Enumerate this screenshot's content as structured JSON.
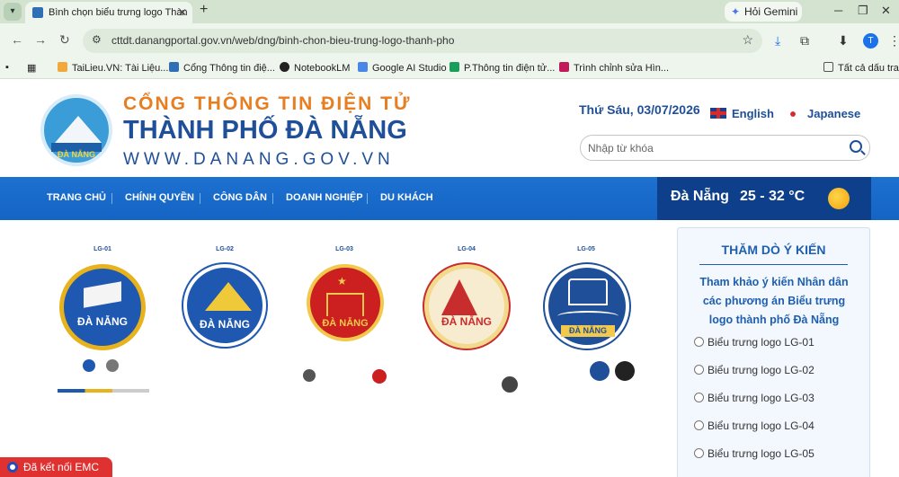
{
  "browser": {
    "tab_title": "Bình chọn biểu trưng logo Thàn",
    "gemini_label": "Hỏi Gemini",
    "url": "cttdt.danangportal.gov.vn/web/dng/binh-chon-bieu-trung-logo-thanh-pho",
    "avatar_letter": "T",
    "bookmarks": [
      "TaiLieu.VN: Tài Liệu...",
      "Cổng Thông tin điệ...",
      "NotebookLM",
      "Google AI Studio",
      "P.Thông tin điện tử...",
      "Trình chỉnh sửa Hìn...",
      "Tất cả dấu trang"
    ]
  },
  "header": {
    "line1": "CỔNG THÔNG TIN ĐIỆN TỬ",
    "line2": "THÀNH PHỐ ĐÀ NẴNG",
    "line3": "WWW.DANANG.GOV.VN",
    "logo_caption": "ĐÀ NẴNG",
    "date": "Thứ Sáu, 03/07/2026",
    "lang_en": "English",
    "lang_jp": "Japanese",
    "search_placeholder": "Nhập từ khóa"
  },
  "nav": {
    "items": [
      "TRANG CHỦ",
      "CHÍNH QUYỀN",
      "CÔNG DÂN",
      "DOANH NGHIỆP",
      "DU KHÁCH"
    ],
    "weather_city": "Đà Nẵng",
    "weather_temp": "25 - 32 °C"
  },
  "logos": [
    {
      "code": "LG-01",
      "name": "ĐÀ NẴNG",
      "color": "#1f58b0",
      "ring": "#e8b21c"
    },
    {
      "code": "LG-02",
      "name": "ĐÀ NẴNG",
      "color": "#1f58b0",
      "ring": "#ffffff"
    },
    {
      "code": "LG-03",
      "name": "ĐÀ NẴNG",
      "color": "#cc1f1f",
      "ring": "#f2c94c"
    },
    {
      "code": "LG-04",
      "name": "ĐÀ NẴNG",
      "color": "#f7ecd0",
      "ring": "#c72d2d"
    },
    {
      "code": "LG-05",
      "name": "ĐÀ NẴNG",
      "color": "#1f4f98",
      "ring": "#ffffff"
    }
  ],
  "poll": {
    "title": "THĂM DÒ Ý KIẾN",
    "description": "Tham khảo ý kiến Nhân dân các phương án Biểu trưng logo thành phố Đà Nẵng",
    "options": [
      "Biểu trưng logo LG-01",
      "Biểu trưng logo LG-02",
      "Biểu trưng logo LG-03",
      "Biểu trưng logo LG-04",
      "Biểu trưng logo LG-05"
    ]
  },
  "emc_label": "Đã kết nối EMC",
  "colors": {
    "primary": "#1f4f98",
    "accent": "#e67e22",
    "nav": "#1464c4",
    "weather_bg": "#0d3f8a",
    "emc": "#e03131"
  }
}
